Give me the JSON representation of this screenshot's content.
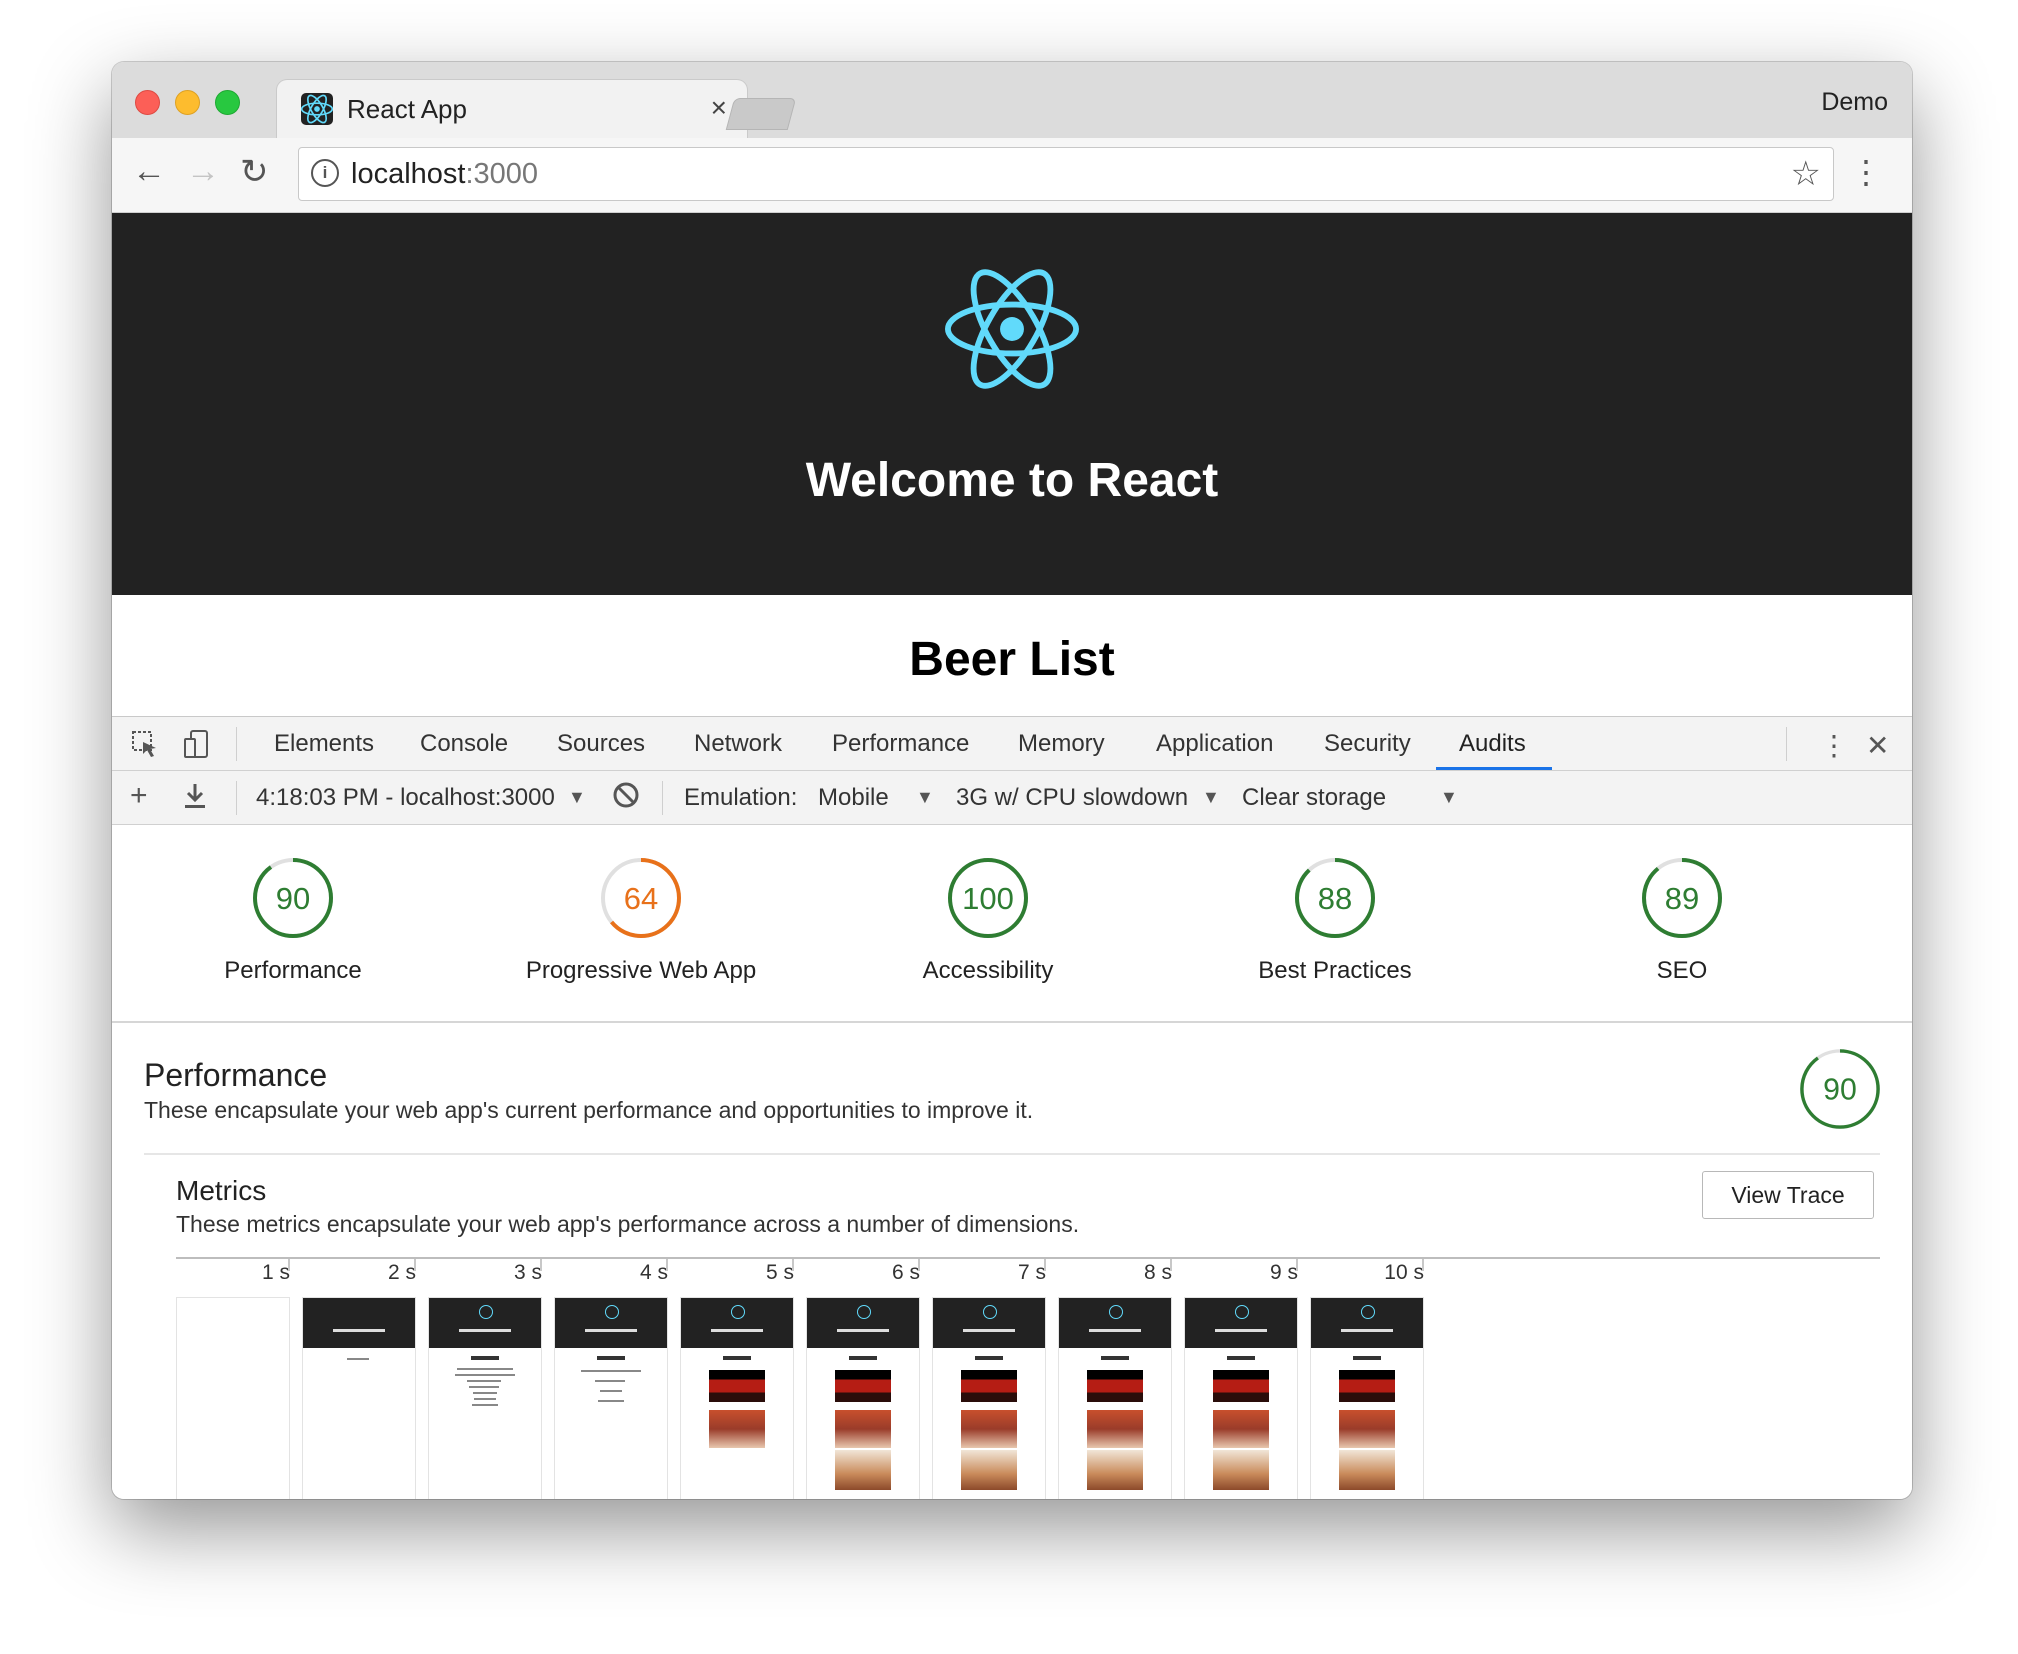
{
  "browser": {
    "tab_title": "React App",
    "tab_close": "×",
    "profile": "Demo",
    "url_host": "localhost",
    "url_port": ":3000"
  },
  "page": {
    "header_title": "Welcome to React",
    "heading": "Beer List",
    "react_color": "#61dafb"
  },
  "devtools": {
    "tabs": [
      "Elements",
      "Console",
      "Sources",
      "Network",
      "Performance",
      "Memory",
      "Application",
      "Security",
      "Audits"
    ],
    "active_tab": "Audits",
    "report_selector": "4:18:03 PM - localhost:3000",
    "emulation_label": "Emulation:",
    "emulation_value": "Mobile",
    "throttling": "3G w/ CPU slowdown",
    "clear_storage": "Clear storage"
  },
  "scores": [
    {
      "label": "Performance",
      "value": 90,
      "color": "#2e7d32"
    },
    {
      "label": "Progressive Web App",
      "value": 64,
      "color": "#e8711a"
    },
    {
      "label": "Accessibility",
      "value": 100,
      "color": "#2e7d32"
    },
    {
      "label": "Best Practices",
      "value": 88,
      "color": "#2e7d32"
    },
    {
      "label": "SEO",
      "value": 89,
      "color": "#2e7d32"
    }
  ],
  "performance": {
    "title": "Performance",
    "description": "These encapsulate your web app's current performance and opportunities to improve it.",
    "score": 90,
    "metrics_title": "Metrics",
    "metrics_description": "These metrics encapsulate your web app's performance across a number of dimensions.",
    "view_trace": "View Trace",
    "timeline_ticks": [
      "1 s",
      "2 s",
      "3 s",
      "4 s",
      "5 s",
      "6 s",
      "7 s",
      "8 s",
      "9 s",
      "10 s"
    ]
  }
}
